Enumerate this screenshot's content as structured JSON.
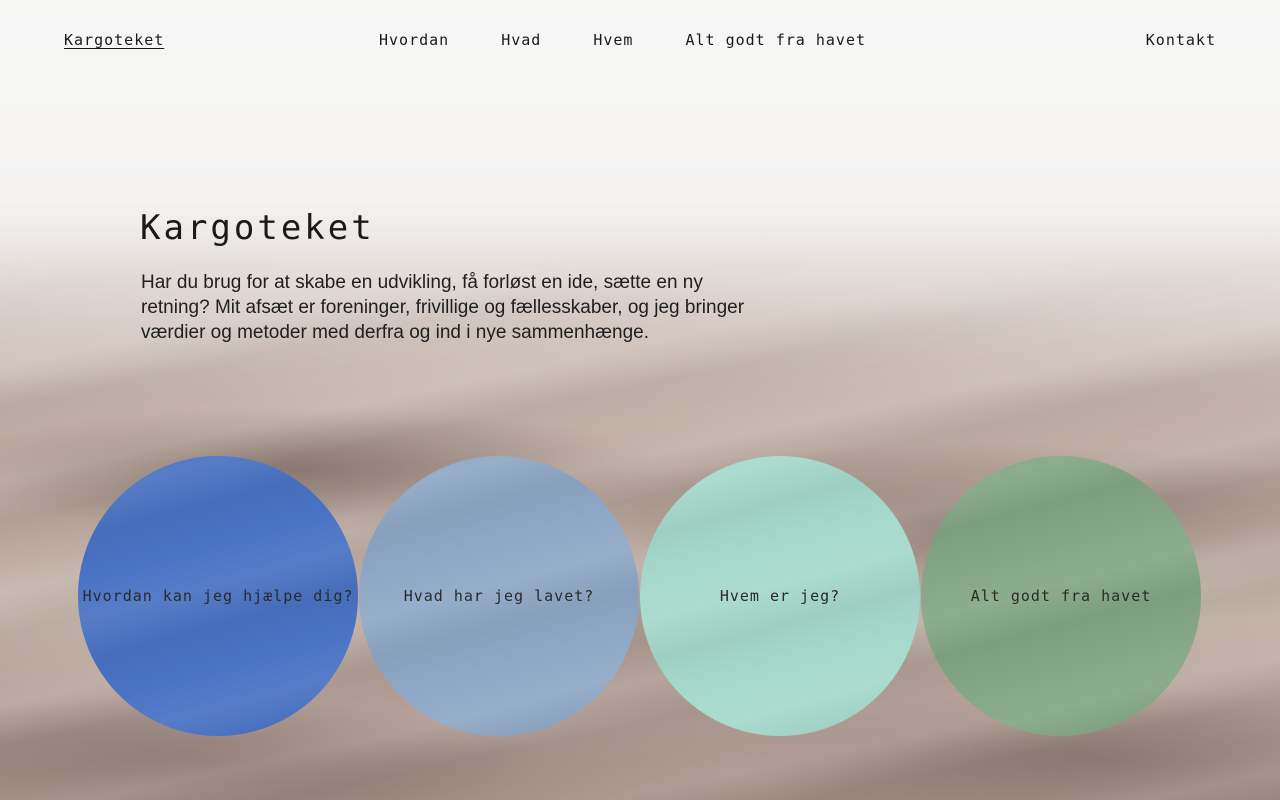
{
  "header": {
    "brand": "Kargoteket",
    "nav": [
      {
        "label": "Hvordan"
      },
      {
        "label": "Hvad"
      },
      {
        "label": "Hvem"
      },
      {
        "label": "Alt godt fra havet"
      }
    ],
    "contact": "Kontakt"
  },
  "hero": {
    "title": "Kargoteket",
    "text": "Har du brug for at skabe en udvikling, få forløst en ide, sætte en ny retning? Mit afsæt er foreninger, frivillige og fællesskaber, og jeg bringer værdier og metoder med derfra og ind i nye sammenhænge."
  },
  "cards": [
    {
      "label": "Hvordan kan jeg hjælpe dig?",
      "color": "#4a73c4"
    },
    {
      "label": "Hvad har jeg lavet?",
      "color": "#8fa8c6"
    },
    {
      "label": "Hvem er jeg?",
      "color": "#a6d9cc"
    },
    {
      "label": "Alt godt fra havet",
      "color": "#84a686"
    }
  ]
}
